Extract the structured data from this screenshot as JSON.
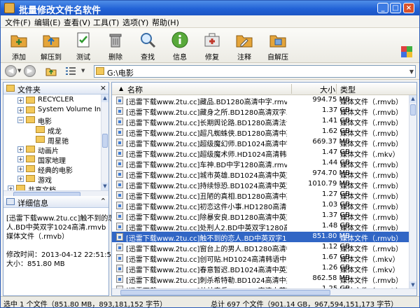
{
  "window": {
    "title": "批量修改文件名软件"
  },
  "menu": [
    "文件(F)",
    "编辑(E)",
    "查看(V)",
    "工具(T)",
    "选项(Y)",
    "帮助(H)"
  ],
  "toolbar": [
    {
      "label": "添加",
      "icon": "add-folder-icon",
      "color": "#e5a53a"
    },
    {
      "label": "解压到",
      "icon": "extract-to-icon",
      "color": "#e5a53a"
    },
    {
      "label": "测试",
      "icon": "test-icon",
      "color": "#6aa84f"
    },
    {
      "label": "删除",
      "icon": "delete-icon",
      "color": "#8a8a8a"
    },
    {
      "label": "查找",
      "icon": "search-icon",
      "color": "#7aa6d8"
    },
    {
      "label": "信息",
      "icon": "info-icon",
      "color": "#58a93a"
    },
    {
      "label": "修复",
      "icon": "repair-icon",
      "color": "#c0392b"
    },
    {
      "label": "注释",
      "icon": "comment-icon",
      "color": "#e5a53a"
    },
    {
      "label": "自解压",
      "icon": "self-extract-icon",
      "color": "#e5a53a"
    }
  ],
  "address": {
    "path": "G:\\电影"
  },
  "folders_pane": {
    "title": "文件夹"
  },
  "tree": [
    {
      "label": "RECYCLER",
      "level": 1,
      "toggle": "+"
    },
    {
      "label": "System Volume In",
      "level": 1,
      "toggle": "+"
    },
    {
      "label": "电影",
      "level": 1,
      "toggle": "-"
    },
    {
      "label": "成龙",
      "level": 2,
      "toggle": ""
    },
    {
      "label": "周星驰",
      "level": 2,
      "toggle": ""
    },
    {
      "label": "动画片",
      "level": 1,
      "toggle": "+"
    },
    {
      "label": "国家地理",
      "level": 1,
      "toggle": "+"
    },
    {
      "label": "经典的电影",
      "level": 1,
      "toggle": "+"
    },
    {
      "label": "游戏",
      "level": 1,
      "toggle": "+"
    },
    {
      "label": "共享文档",
      "level": 0,
      "toggle": "+"
    }
  ],
  "details_pane": {
    "title": "详细信息",
    "lines": [
      "[迅雷下载www.2tu.cc]触不到的恋",
      "人.BD中英双字1024高清.rmvb",
      "媒体文件（.rmvb）",
      "",
      "修改时间：2013-04-12 22:51:59",
      "大小：851.80 MB"
    ]
  },
  "columns": {
    "name": "名称",
    "size": "大小",
    "type": "类型"
  },
  "files": [
    {
      "name": "[迅雷下载www.2tu.cc]藏品.BD1280高清中字.rmvb",
      "size": "994.75 MB",
      "type": "媒体文件（.rmvb）"
    },
    {
      "name": "[迅雷下载www.2tu.cc]藏身之所.BD1280高清双字.rmvb",
      "size": "1.37 GB",
      "type": "媒体文件（.rmvb）"
    },
    {
      "name": "[迅雷下载www.2tu.cc]长期舆论路.BD1280高清法语中字.rmvb",
      "size": "1.41 GB",
      "type": "媒体文件（.rmvb）"
    },
    {
      "name": "[迅雷下载www.2tu.cc]超凡蜘蛛侠.BD1280高清中英双字.rmvb",
      "size": "1.62 GB",
      "type": "媒体文件（.rmvb）"
    },
    {
      "name": "[迅雷下载www.2tu.cc]超级魔幻师.BD1024高清中字.rmvb",
      "size": "669.37 MB",
      "type": "媒体文件（.rmvb）"
    },
    {
      "name": "[迅雷下载www.2tu.cc]超级魔术师.HD1024高清韩语中字.mkv",
      "size": "1.47 GB",
      "type": "媒体文件（.mkv）"
    },
    {
      "name": "[迅雷下载www.2tu.cc]车神.BD中字1280高清.rmvb",
      "size": "1.44 GB",
      "type": "媒体文件（.rmvb）"
    },
    {
      "name": "[迅雷下载www.2tu.cc]城市英雄.BD1024高清中英双字.rmvb",
      "size": "974.70 MB",
      "type": "媒体文件（.rmvb）"
    },
    {
      "name": "[迅雷下载www.2tu.cc]持续惊恐.BD1024高清中英双字.rmvb",
      "size": "1010.79 MB",
      "type": "媒体文件（.rmvb）"
    },
    {
      "name": "[迅雷下载www.2tu.cc]丑陋的真相.BD1280高清中英双字.rmvb",
      "size": "1.27 GB",
      "type": "媒体文件（.rmvb）"
    },
    {
      "name": "[迅雷下载www.2tu.cc]初恋这件小事.HD1280高清泰语中字.rmvb",
      "size": "1.03 GB",
      "type": "媒体文件（.rmvb）"
    },
    {
      "name": "[迅雷下载www.2tu.cc]除暴安良.BD1280高清中英双字.rmvb",
      "size": "1.37 GB",
      "type": "媒体文件（.rmvb）"
    },
    {
      "name": "[迅雷下载www.2tu.cc]处刑人2.BD中英双字1280高清.rmvb",
      "size": "1.48 GB",
      "type": "媒体文件（.rmvb）"
    },
    {
      "name": "[迅雷下载www.2tu.cc]触不到的恋人.BD中英双字1024高清.rmvb",
      "size": "851.80 MB",
      "type": "媒体文件（.rmvb）",
      "selected": true
    },
    {
      "name": "[迅雷下载www.2tu.cc]窗台上的男人.BD1280高清中英双字.rmvb",
      "size": "1.12 GB",
      "type": "媒体文件（.rmvb）"
    },
    {
      "name": "[迅雷下载www.2tu.cc]创可贴.HD1024高清韩语中字.mkv",
      "size": "1.67 GB",
      "type": "媒体文件（.mkv）"
    },
    {
      "name": "[迅雷下载www.2tu.cc]春意暂迟.BD1024高清中英双字.mkv",
      "size": "1.26 GB",
      "type": "媒体文件（.mkv）"
    },
    {
      "name": "[迅雷下载www.2tu.cc]刺杀希特勒.BD1024高清中英双字.rmvb",
      "size": "862.58 MB",
      "type": "媒体文件（.rmvb）"
    },
    {
      "name": "[迅雷下载www.2tu.cc]丛林奇兵.BD1280高清中英双字.rmvb",
      "size": "1.25 GB",
      "type": "媒体文件（.rmvb）"
    },
    {
      "name": "[迅雷下载www.2tu.cc]大地惊雷.BD1280高清中英双字.rmvb",
      "size": "1.37 GB",
      "type": "媒体文件（.rmvb）"
    },
    {
      "name": "[迅雷下载www.2tu.cc]大河恋.BD1280高清中英双字.rmvb",
      "size": "1.27 GB",
      "type": "媒体文件（.rmvb）"
    }
  ],
  "status": {
    "left": "选中 1 个文件（851.80 MB，893,181,152 字节）",
    "right": "总计 697 个文件（901.14 GB，967,594,151,173 字节）"
  },
  "colors": {
    "title_bar": "#2262d6",
    "selection": "#3166c5"
  }
}
